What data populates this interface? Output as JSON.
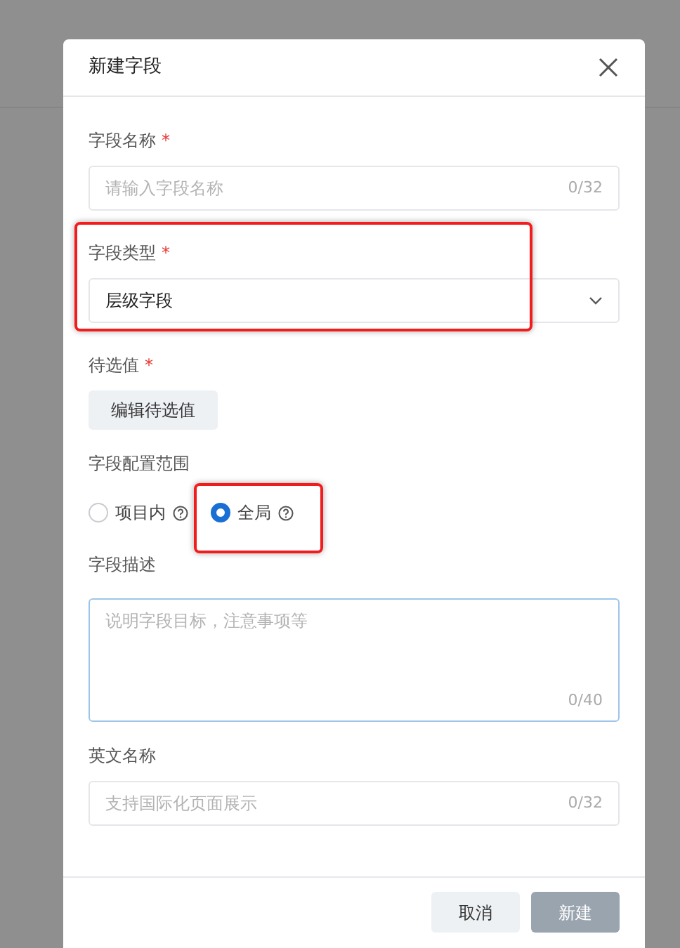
{
  "dialog": {
    "title": "新建字段"
  },
  "fields": [
    {
      "kind": "input",
      "label": "字段名称",
      "required_mark": "*",
      "placeholder": "请输入字段名称",
      "counter": "0/32"
    },
    {
      "kind": "select",
      "label": "字段类型",
      "required_mark": "*",
      "value": "层级字段",
      "highlighted": true
    },
    {
      "kind": "button",
      "label": "待选值",
      "required_mark": "*",
      "button": "编辑待选值"
    },
    {
      "kind": "radio",
      "label": "字段配置范围",
      "options": [
        {
          "label": "项目内",
          "selected": false,
          "highlighted": false
        },
        {
          "label": "全局",
          "selected": true,
          "highlighted": true
        }
      ]
    },
    {
      "kind": "textarea",
      "label": "字段描述",
      "placeholder": "说明字段目标，注意事项等",
      "counter": "0/40",
      "focused": true
    },
    {
      "kind": "input",
      "label": "英文名称",
      "placeholder": "支持国际化页面展示",
      "counter": "0/32"
    }
  ],
  "footer_buttons": [
    {
      "label": "取消",
      "kind": "secondary",
      "disabled": false
    },
    {
      "label": "新建",
      "kind": "primary",
      "disabled": true
    }
  ]
}
